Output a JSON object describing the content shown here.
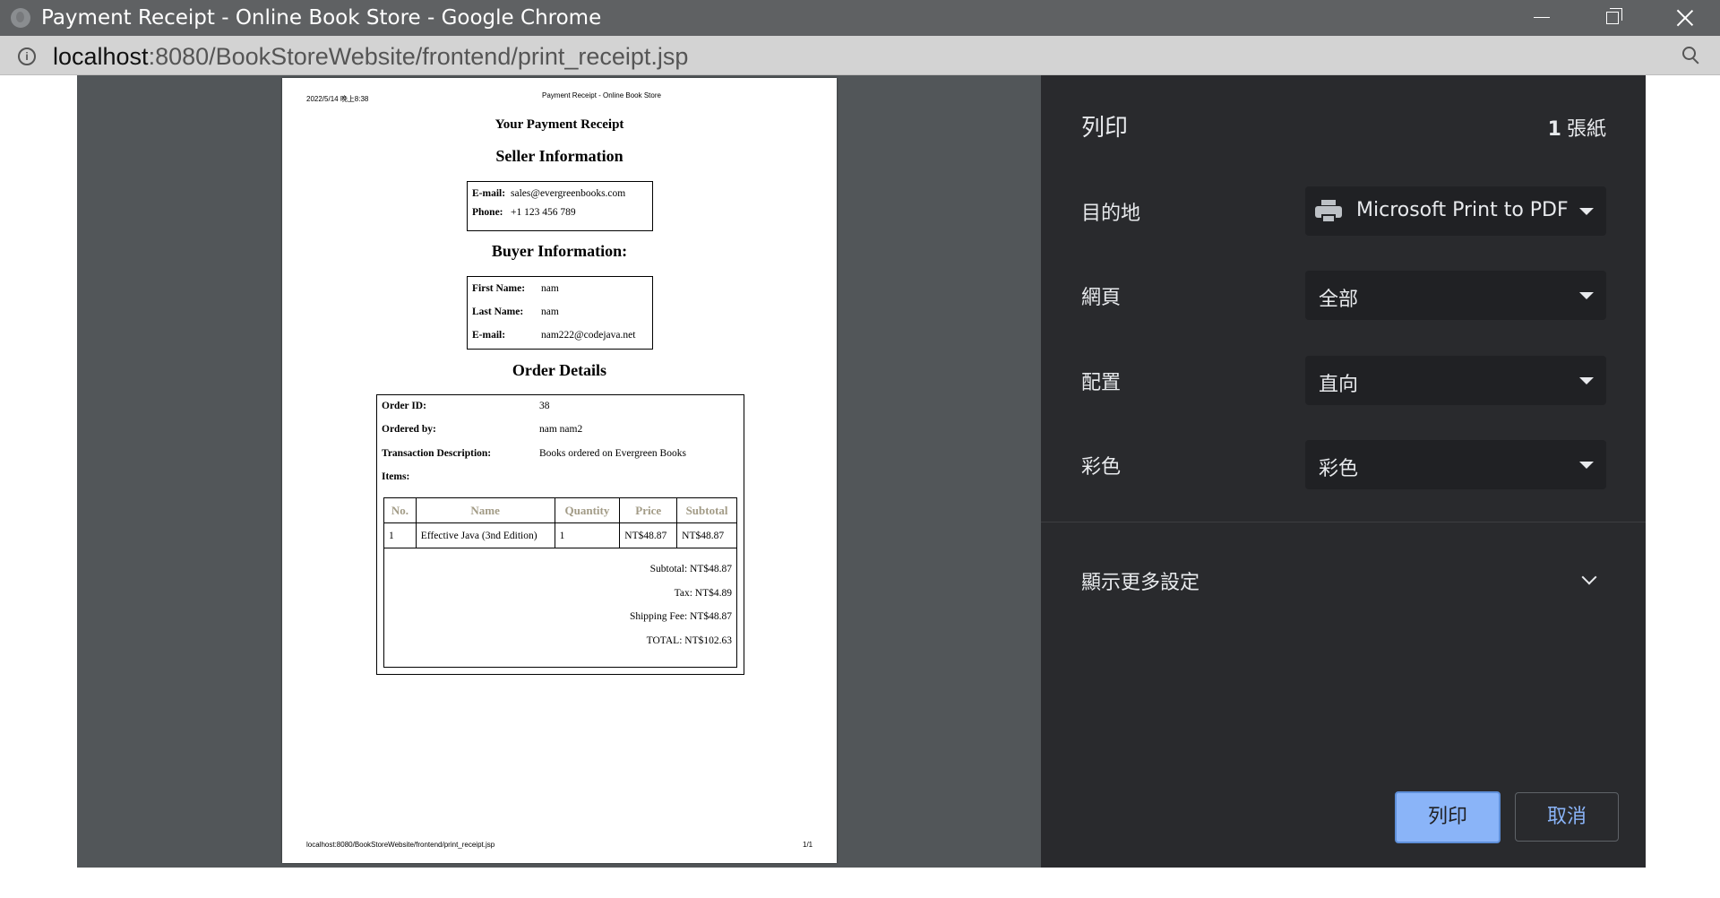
{
  "window": {
    "title": "Payment Receipt - Online Book Store - Google Chrome"
  },
  "address_bar": {
    "url_host": "localhost",
    "url_path": ":8080/BookStoreWebsite/frontend/print_receipt.jsp"
  },
  "preview": {
    "header_date": "2022/5/14 晚上8:38",
    "header_title": "Payment Receipt - Online Book Store",
    "footer_url": "localhost:8080/BookStoreWebsite/frontend/print_receipt.jsp",
    "footer_page": "1/1",
    "receipt_heading": "Your Payment Receipt",
    "seller": {
      "heading": "Seller Information",
      "email_label": "E-mail:",
      "email": "sales@evergreenbooks.com",
      "phone_label": "Phone:",
      "phone": "+1 123 456 789"
    },
    "buyer": {
      "heading": "Buyer Information:",
      "first_name_label": "First Name:",
      "first_name": "nam",
      "last_name_label": "Last Name:",
      "last_name": "nam",
      "email_label": "E-mail:",
      "email": "nam222@codejava.net"
    },
    "order": {
      "heading": "Order Details",
      "order_id_label": "Order ID:",
      "order_id": "38",
      "ordered_by_label": "Ordered by:",
      "ordered_by": "nam nam2",
      "description_label": "Transaction Description:",
      "description": "Books ordered on Evergreen Books",
      "items_label": "Items:",
      "columns": [
        "No.",
        "Name",
        "Quantity",
        "Price",
        "Subtotal"
      ],
      "items": [
        {
          "no": "1",
          "name": "Effective Java (3nd Edition)",
          "quantity": "1",
          "price": "NT$48.87",
          "subtotal": "NT$48.87"
        }
      ],
      "subtotal": "Subtotal: NT$48.87",
      "tax": "Tax: NT$4.89",
      "shipping": "Shipping Fee: NT$48.87",
      "total": "TOTAL: NT$102.63"
    }
  },
  "settings": {
    "title": "列印",
    "sheet_count": "1",
    "sheet_unit": "張紙",
    "destination_label": "目的地",
    "destination_value": "Microsoft Print to PDF",
    "pages_label": "網頁",
    "pages_value": "全部",
    "layout_label": "配置",
    "layout_value": "直向",
    "color_label": "彩色",
    "color_value": "彩色",
    "more_settings": "顯示更多設定",
    "print_button": "列印",
    "cancel_button": "取消"
  }
}
